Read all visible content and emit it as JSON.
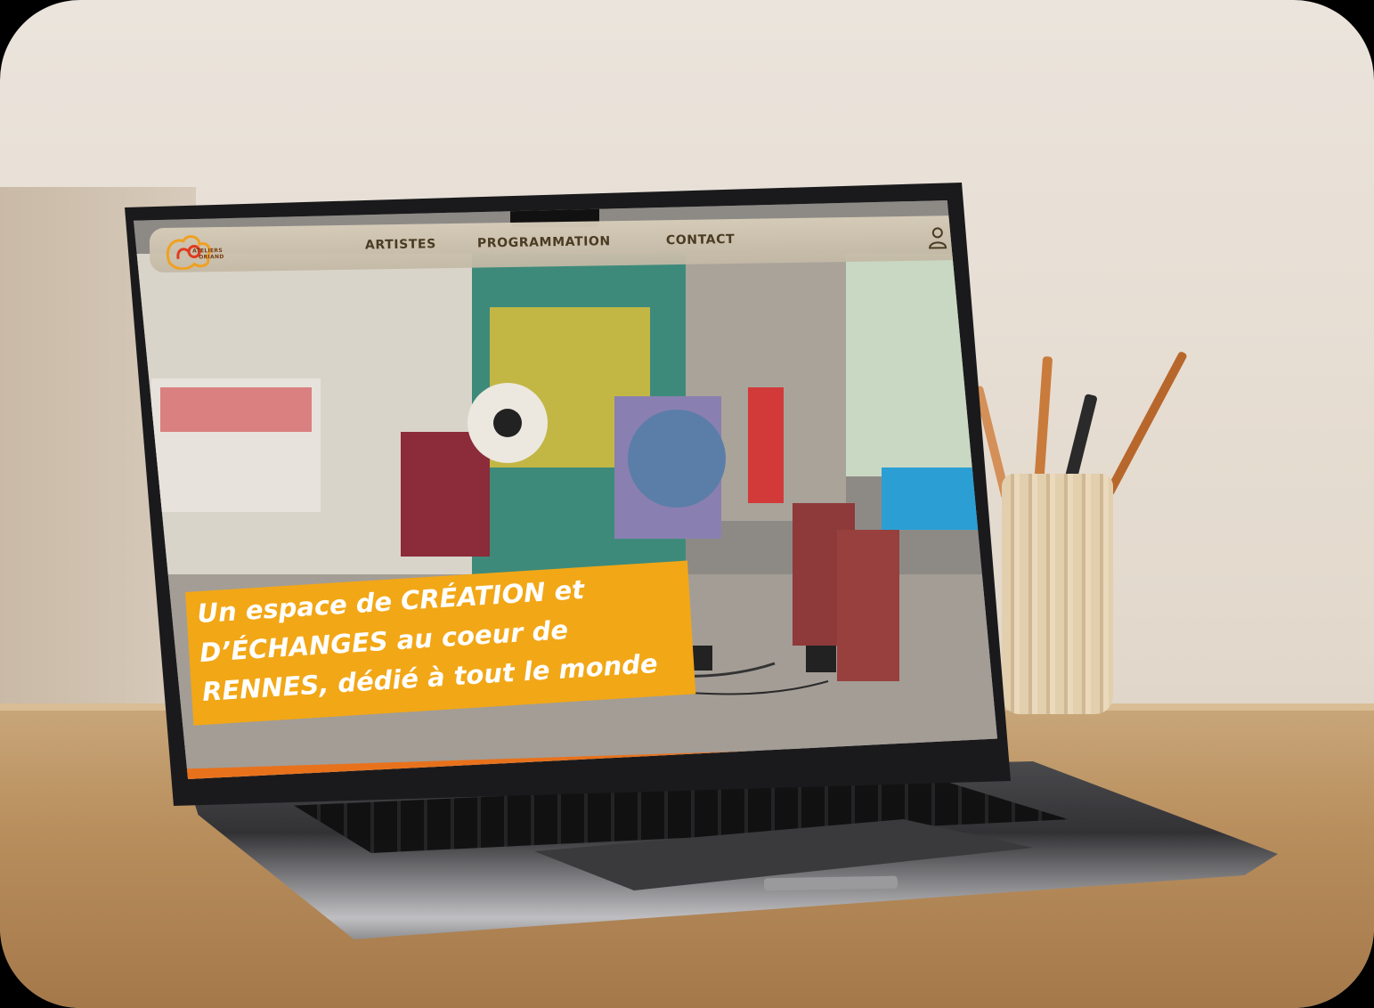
{
  "site": {
    "logo_text": [
      "ATELIERS",
      "ORIAND"
    ],
    "nav": [
      {
        "label": "ARTISTES"
      },
      {
        "label": "PROGRAMMATION"
      },
      {
        "label": "CONTACT"
      }
    ],
    "account_icon": "user-icon"
  },
  "hero": {
    "headline_lines": [
      "Un espace de CRÉATION et",
      "D’ÉCHANGES au coeur de",
      "RENNES, dédié à tout le monde"
    ]
  },
  "colors": {
    "banner": "#f2a717",
    "accent_strip": "#e8721c",
    "navbar": "#d7cdb9"
  }
}
